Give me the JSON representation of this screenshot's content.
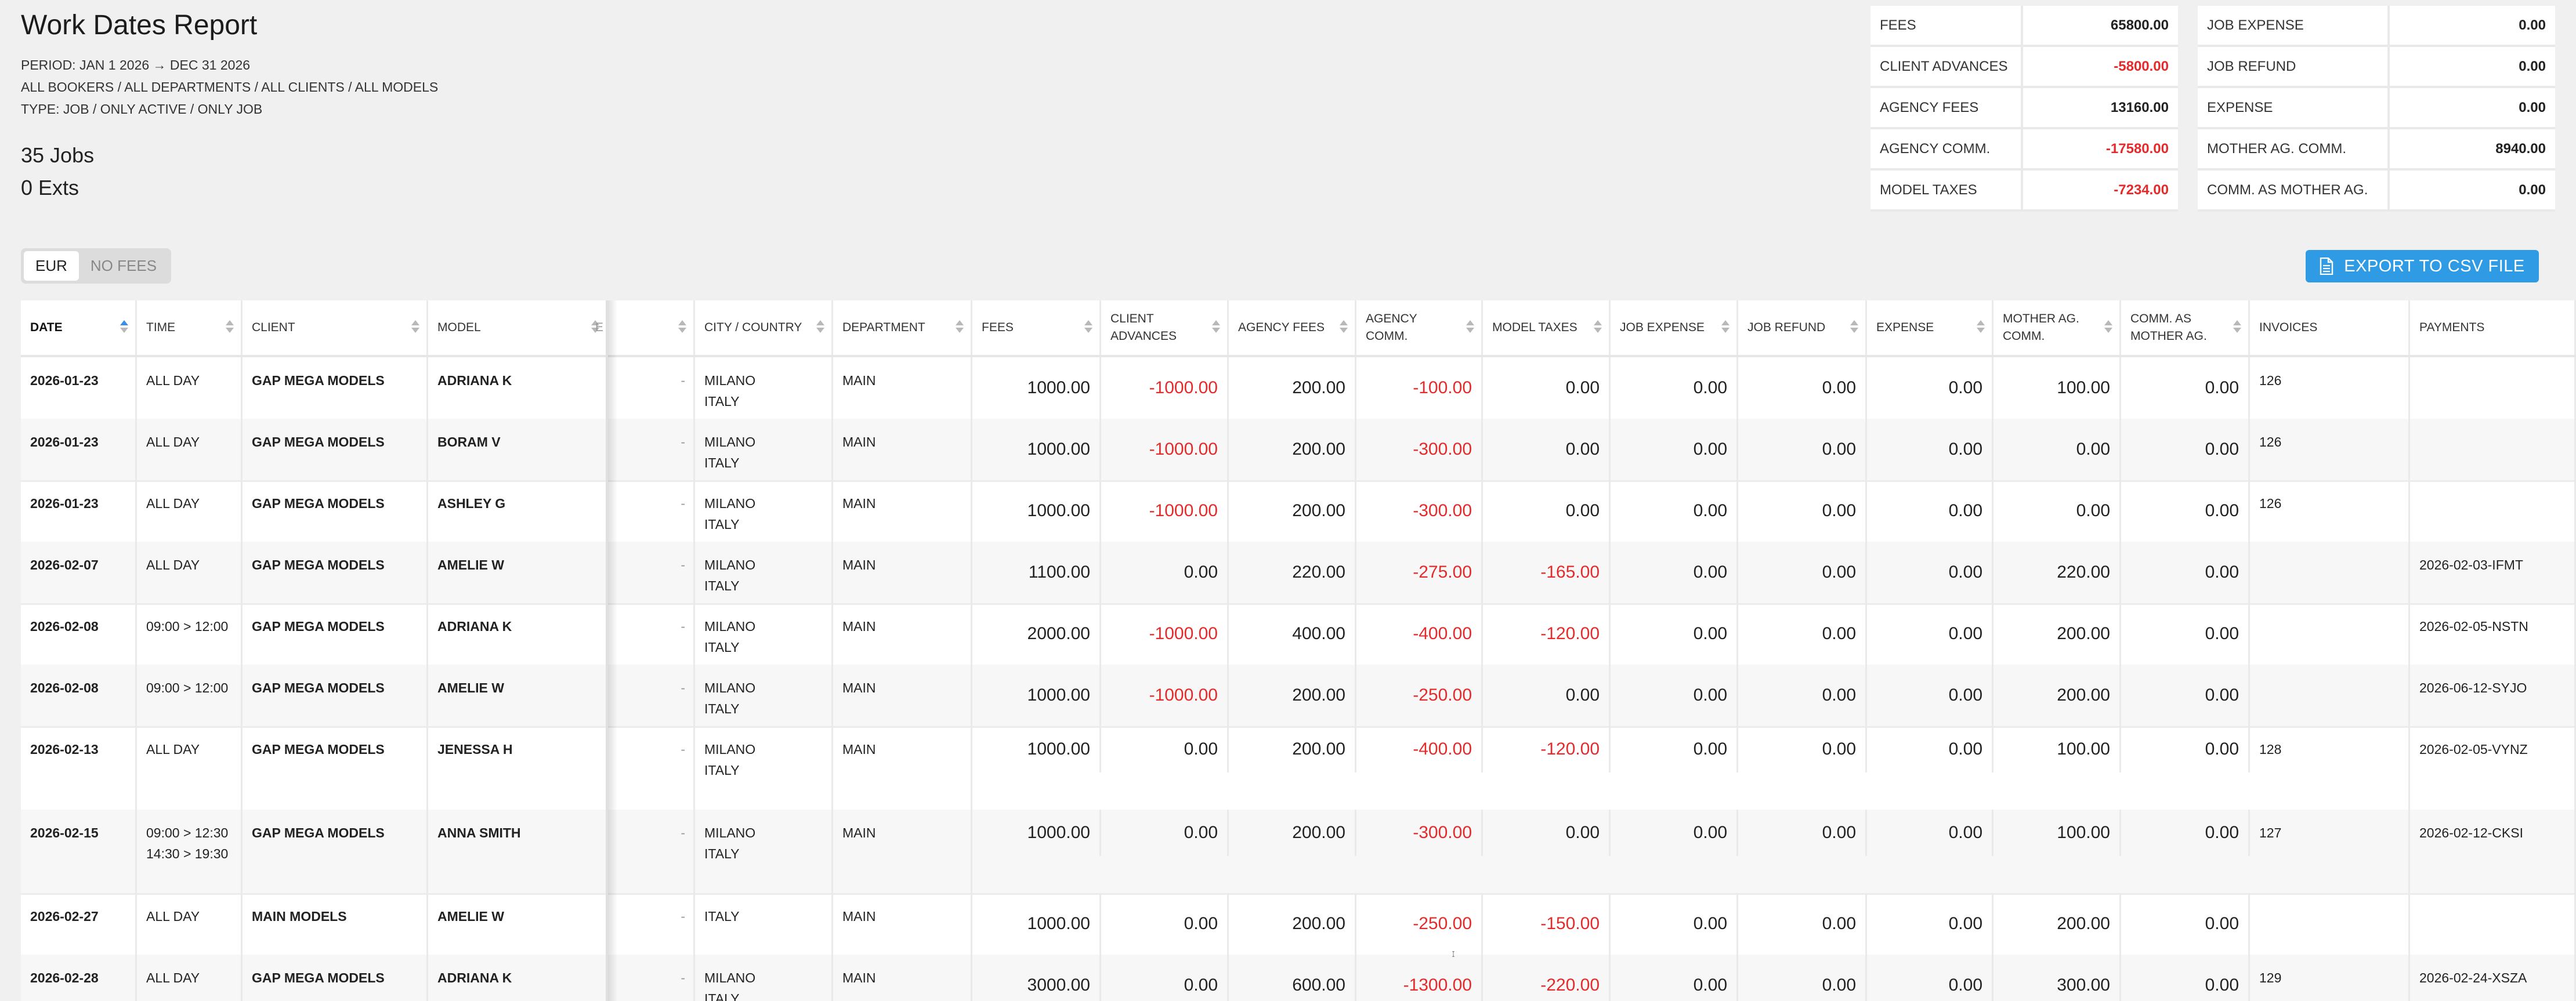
{
  "report": {
    "title": "Work Dates Report",
    "period": "PERIOD: JAN 1 2026 → DEC 31 2026",
    "filters": "ALL BOOKERS / ALL DEPARTMENTS / ALL CLIENTS / ALL MODELS",
    "type": "TYPE: JOB / ONLY ACTIVE / ONLY JOB",
    "jobs_count": "35 Jobs",
    "exts_count": "0 Exts"
  },
  "summary_left": [
    {
      "label": "FEES",
      "value": "65800.00",
      "negative": false
    },
    {
      "label": "CLIENT ADVANCES",
      "value": "-5800.00",
      "negative": true
    },
    {
      "label": "AGENCY FEES",
      "value": "13160.00",
      "negative": false
    },
    {
      "label": "AGENCY COMM.",
      "value": "-17580.00",
      "negative": true
    },
    {
      "label": "MODEL TAXES",
      "value": "-7234.00",
      "negative": true
    }
  ],
  "summary_right": [
    {
      "label": "JOB EXPENSE",
      "value": "0.00",
      "negative": false
    },
    {
      "label": "JOB REFUND",
      "value": "0.00",
      "negative": false
    },
    {
      "label": "EXPENSE",
      "value": "0.00",
      "negative": false
    },
    {
      "label": "MOTHER AG. COMM.",
      "value": "8940.00",
      "negative": false
    },
    {
      "label": "COMM. AS MOTHER AG.",
      "value": "0.00",
      "negative": false
    }
  ],
  "currency_toggle": {
    "options": [
      "EUR",
      "NO FEES"
    ],
    "selected": "EUR"
  },
  "export_button": {
    "label": "EXPORT TO CSV FILE",
    "icon": "file-icon"
  },
  "colors": {
    "accent": "#2f9be5",
    "negative": "#e32b2b",
    "sort_active": "#3a8ee6"
  },
  "table": {
    "columns": [
      {
        "key": "date",
        "label": "DATE",
        "sort": "asc"
      },
      {
        "key": "time",
        "label": "TIME"
      },
      {
        "key": "client",
        "label": "CLIENT"
      },
      {
        "key": "model",
        "label": "MODEL"
      },
      {
        "key": "hidden",
        "label": "E"
      },
      {
        "key": "city",
        "label": "CITY / COUNTRY"
      },
      {
        "key": "department",
        "label": "DEPARTMENT"
      },
      {
        "key": "fees",
        "label": "FEES"
      },
      {
        "key": "client_adv",
        "label": "CLIENT ADVANCES"
      },
      {
        "key": "agency_fees",
        "label": "AGENCY FEES"
      },
      {
        "key": "agency_comm",
        "label": "AGENCY COMM."
      },
      {
        "key": "model_taxes",
        "label": "MODEL TAXES"
      },
      {
        "key": "job_expense",
        "label": "JOB EXPENSE"
      },
      {
        "key": "job_refund",
        "label": "JOB REFUND"
      },
      {
        "key": "expense",
        "label": "EXPENSE"
      },
      {
        "key": "mother_comm",
        "label": "MOTHER AG. COMM."
      },
      {
        "key": "comm_mother",
        "label": "COMM. AS MOTHER AG."
      },
      {
        "key": "invoices",
        "label": "INVOICES"
      },
      {
        "key": "payments",
        "label": "PAYMENTS"
      }
    ],
    "rows": [
      {
        "date": "2026-01-23",
        "time": [
          "ALL DAY"
        ],
        "client": "GAP MEGA MODELS",
        "model": "ADRIANA K",
        "hidden": "-",
        "city": [
          "MILANO",
          "ITALY"
        ],
        "department": "MAIN",
        "fees": "1000.00",
        "client_adv": "-1000.00",
        "agency_fees": "200.00",
        "agency_comm": "-100.00",
        "model_taxes": "0.00",
        "job_expense": "0.00",
        "job_refund": "0.00",
        "expense": "0.00",
        "mother_comm": "100.00",
        "comm_mother": "0.00",
        "invoices": "126",
        "payments": ""
      },
      {
        "date": "2026-01-23",
        "time": [
          "ALL DAY"
        ],
        "client": "GAP MEGA MODELS",
        "model": "BORAM V",
        "hidden": "-",
        "city": [
          "MILANO",
          "ITALY"
        ],
        "department": "MAIN",
        "fees": "1000.00",
        "client_adv": "-1000.00",
        "agency_fees": "200.00",
        "agency_comm": "-300.00",
        "model_taxes": "0.00",
        "job_expense": "0.00",
        "job_refund": "0.00",
        "expense": "0.00",
        "mother_comm": "0.00",
        "comm_mother": "0.00",
        "invoices": "126",
        "payments": ""
      },
      {
        "date": "2026-01-23",
        "time": [
          "ALL DAY"
        ],
        "client": "GAP MEGA MODELS",
        "model": "ASHLEY G",
        "hidden": "-",
        "city": [
          "MILANO",
          "ITALY"
        ],
        "department": "MAIN",
        "fees": "1000.00",
        "client_adv": "-1000.00",
        "agency_fees": "200.00",
        "agency_comm": "-300.00",
        "model_taxes": "0.00",
        "job_expense": "0.00",
        "job_refund": "0.00",
        "expense": "0.00",
        "mother_comm": "0.00",
        "comm_mother": "0.00",
        "invoices": "126",
        "payments": ""
      },
      {
        "date": "2026-02-07",
        "time": [
          "ALL DAY"
        ],
        "client": "GAP MEGA MODELS",
        "model": "AMELIE W",
        "hidden": "-",
        "city": [
          "MILANO",
          "ITALY"
        ],
        "department": "MAIN",
        "fees": "1100.00",
        "client_adv": "0.00",
        "agency_fees": "220.00",
        "agency_comm": "-275.00",
        "model_taxes": "-165.00",
        "job_expense": "0.00",
        "job_refund": "0.00",
        "expense": "0.00",
        "mother_comm": "220.00",
        "comm_mother": "0.00",
        "invoices": "",
        "payments": "2026-02-03-IFMT"
      },
      {
        "date": "2026-02-08",
        "time": [
          "09:00 > 12:00"
        ],
        "client": "GAP MEGA MODELS",
        "model": "ADRIANA K",
        "hidden": "-",
        "city": [
          "MILANO",
          "ITALY"
        ],
        "department": "MAIN",
        "fees": "2000.00",
        "client_adv": "-1000.00",
        "agency_fees": "400.00",
        "agency_comm": "-400.00",
        "model_taxes": "-120.00",
        "job_expense": "0.00",
        "job_refund": "0.00",
        "expense": "0.00",
        "mother_comm": "200.00",
        "comm_mother": "0.00",
        "invoices": "",
        "payments": "2026-02-05-NSTN"
      },
      {
        "date": "2026-02-08",
        "time": [
          "09:00 > 12:00"
        ],
        "client": "GAP MEGA MODELS",
        "model": "AMELIE W",
        "hidden": "-",
        "city": [
          "MILANO",
          "ITALY"
        ],
        "department": "MAIN",
        "fees": "1000.00",
        "client_adv": "-1000.00",
        "agency_fees": "200.00",
        "agency_comm": "-250.00",
        "model_taxes": "0.00",
        "job_expense": "0.00",
        "job_refund": "0.00",
        "expense": "0.00",
        "mother_comm": "200.00",
        "comm_mother": "0.00",
        "invoices": "",
        "payments": "2026-06-12-SYJO"
      },
      {
        "date": "2026-02-13",
        "time": [
          "ALL DAY"
        ],
        "client": "GAP MEGA MODELS",
        "model": "JENESSA H",
        "hidden": "-",
        "city": [
          "MILANO",
          "ITALY"
        ],
        "department": "MAIN",
        "fees": "1000.00",
        "client_adv": "0.00",
        "agency_fees": "200.00",
        "agency_comm": "-400.00",
        "model_taxes": "-120.00",
        "job_expense": "0.00",
        "job_refund": "0.00",
        "expense": "0.00",
        "mother_comm": "100.00",
        "comm_mother": "0.00",
        "invoices": "128",
        "payments": "2026-02-05-VYNZ"
      },
      {
        "date": "2026-02-15",
        "time": [
          "09:00 > 12:30",
          "14:30 > 19:30"
        ],
        "client": "GAP MEGA MODELS",
        "model": "ANNA SMITH",
        "hidden": "-",
        "city": [
          "MILANO",
          "ITALY"
        ],
        "department": "MAIN",
        "fees": "1000.00",
        "client_adv": "0.00",
        "agency_fees": "200.00",
        "agency_comm": "-300.00",
        "model_taxes": "0.00",
        "job_expense": "0.00",
        "job_refund": "0.00",
        "expense": "0.00",
        "mother_comm": "100.00",
        "comm_mother": "0.00",
        "invoices": "127",
        "payments": "2026-02-12-CKSI"
      },
      {
        "date": "2026-02-27",
        "time": [
          "ALL DAY"
        ],
        "client": "MAIN MODELS",
        "model": "AMELIE W",
        "hidden": "-",
        "city": [
          "ITALY"
        ],
        "department": "MAIN",
        "fees": "1000.00",
        "client_adv": "0.00",
        "agency_fees": "200.00",
        "agency_comm": "-250.00",
        "model_taxes": "-150.00",
        "job_expense": "0.00",
        "job_refund": "0.00",
        "expense": "0.00",
        "mother_comm": "200.00",
        "comm_mother": "0.00",
        "invoices": "",
        "payments": ""
      },
      {
        "date": "2026-02-28",
        "time": [
          "ALL DAY"
        ],
        "client": "GAP MEGA MODELS",
        "model": "ADRIANA K",
        "hidden": "-",
        "city": [
          "MILANO",
          "ITALY"
        ],
        "department": "MAIN",
        "fees": "3000.00",
        "client_adv": "0.00",
        "agency_fees": "600.00",
        "agency_comm": "-1300.00",
        "model_taxes": "-220.00",
        "job_expense": "0.00",
        "job_refund": "0.00",
        "expense": "0.00",
        "mother_comm": "300.00",
        "comm_mother": "0.00",
        "invoices": "129",
        "payments": "2026-02-24-XSZA"
      }
    ]
  }
}
